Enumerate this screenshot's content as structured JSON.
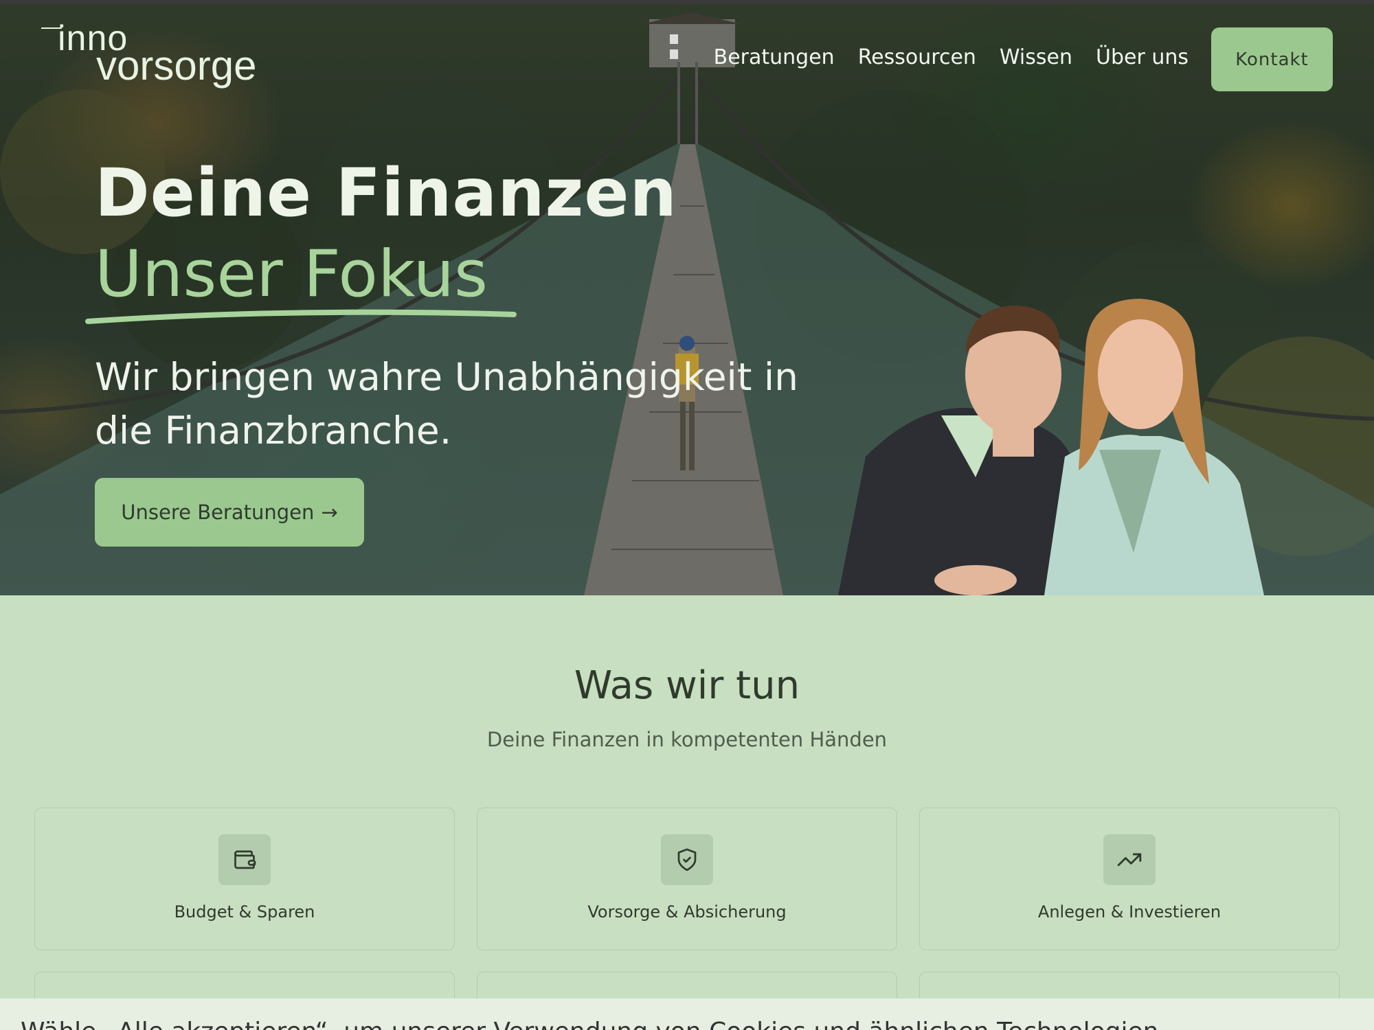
{
  "brand": {
    "line1": "inno",
    "line2": "vorsorge"
  },
  "nav": {
    "items": [
      "Beratungen",
      "Ressourcen",
      "Wissen",
      "Über uns"
    ],
    "contact_label": "Kontakt"
  },
  "hero": {
    "headline": "Deine Finanzen",
    "headline_accent": "Unser Fokus",
    "lead": "Wir bringen wahre Unabhängigkeit in die Finanzbranche.",
    "cta_label": "Unsere Beratungen",
    "cta_arrow": "→"
  },
  "services": {
    "title": "Was wir tun",
    "subtitle": "Deine Finanzen in kompetenten Händen",
    "cards": [
      {
        "label": "Budget & Sparen",
        "icon": "wallet-icon"
      },
      {
        "label": "Vorsorge & Absicherung",
        "icon": "shield-check-icon"
      },
      {
        "label": "Anlegen & Investieren",
        "icon": "trending-up-icon"
      }
    ]
  },
  "cookie": {
    "text": "Wähle „Alle akzeptieren“, um unserer Verwendung von Cookies und ähnlichen Technologien"
  },
  "colors": {
    "accent": "#9bc88f",
    "accent_text": "#a8d49b",
    "section_bg": "#c8dfc1",
    "dark_text": "#2f3b2c"
  }
}
